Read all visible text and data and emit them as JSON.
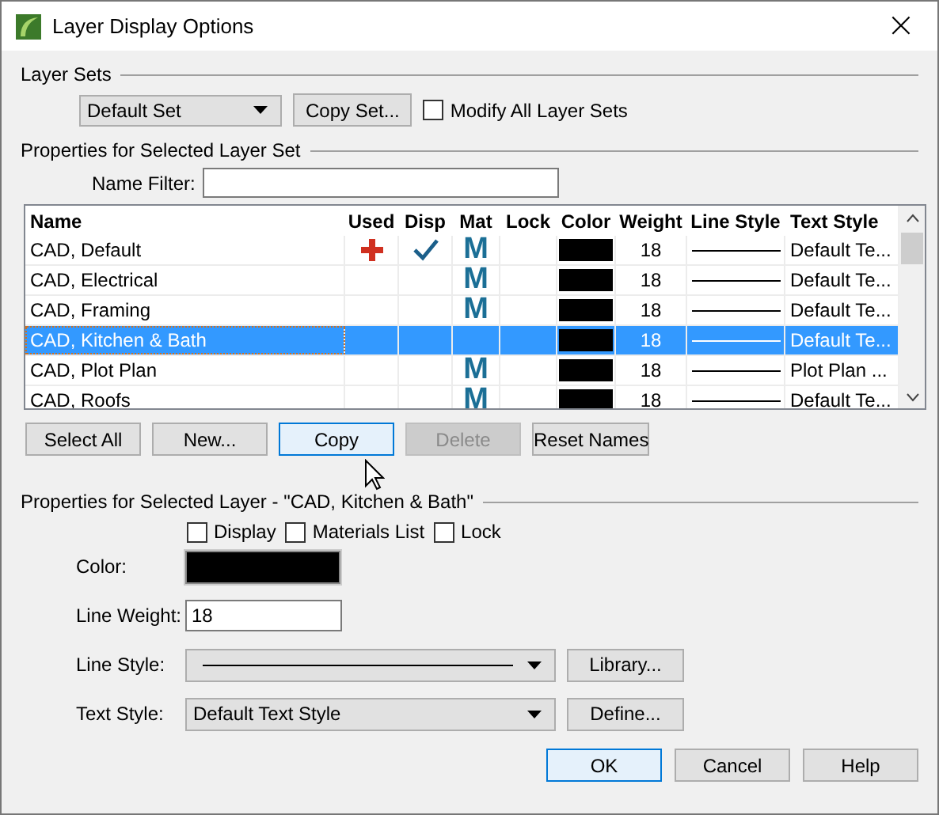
{
  "window": {
    "title": "Layer Display Options",
    "close": "×"
  },
  "layer_sets": {
    "heading": "Layer Sets",
    "set": "Default Set",
    "copy_button": "Copy Set...",
    "modify_all": {
      "label": "Modify All Layer Sets",
      "checked": false
    }
  },
  "layer_set_properties": {
    "heading": "Properties for Selected Layer Set",
    "name_filter_label": "Name Filter:"
  },
  "table": {
    "columns": [
      "Name",
      "Used",
      "Disp",
      "Mat",
      "Lock",
      "Color",
      "Weight",
      "Line Style",
      "Text Style"
    ],
    "rows": [
      {
        "name": "CAD,  Default",
        "used": true,
        "displayed": true,
        "mat": "M",
        "locked": false,
        "color": "#000000",
        "weight": "18",
        "text_style": "Default Te...",
        "selected": false
      },
      {
        "name": "CAD, Electrical",
        "used": false,
        "displayed": false,
        "mat": "M",
        "locked": false,
        "color": "#000000",
        "weight": "18",
        "text_style": "Default Te...",
        "selected": false
      },
      {
        "name": "CAD, Framing",
        "used": false,
        "displayed": false,
        "mat": "M",
        "locked": false,
        "color": "#000000",
        "weight": "18",
        "text_style": "Default Te...",
        "selected": false
      },
      {
        "name": "CAD, Kitchen & Bath",
        "used": false,
        "displayed": false,
        "locked": false,
        "color": "#000000",
        "weight": "18",
        "text_style": "Default Te...",
        "selected": true
      },
      {
        "name": "CAD, Plot Plan",
        "used": false,
        "displayed": false,
        "mat": "M",
        "locked": false,
        "color": "#000000",
        "weight": "18",
        "text_style": "Plot Plan ...",
        "selected": false
      },
      {
        "name": "CAD, Roofs",
        "used": false,
        "displayed": false,
        "mat": "M",
        "locked": false,
        "color": "#000000",
        "weight": "18",
        "text_style": "Default Te...",
        "selected": false
      }
    ]
  },
  "table_buttons": [
    {
      "label": "Select All",
      "disabled": false,
      "focused": false
    },
    {
      "label": "New...",
      "disabled": false,
      "focused": false
    },
    {
      "label": "Copy",
      "disabled": false,
      "focused": true
    },
    {
      "label": "Delete",
      "disabled": true,
      "focused": false
    },
    {
      "label": "Reset Names",
      "disabled": false,
      "focused": false
    }
  ],
  "layer_properties": {
    "heading": "Properties for Selected Layer - \"CAD, Kitchen & Bath\"",
    "checkboxes": [
      {
        "label": "Display",
        "checked": false
      },
      {
        "label": "Materials List",
        "checked": false
      },
      {
        "label": "Lock",
        "checked": false
      }
    ],
    "color_label": "Color:",
    "color": "#000000",
    "line_weight_label": "Line Weight:",
    "line_weight": "18",
    "line_style_label": "Line Style:",
    "library_button": "Library...",
    "text_style_label": "Text Style:",
    "text_style": "Default Text Style",
    "define_button": "Define..."
  },
  "buttons": [
    "OK",
    "Cancel",
    "Help"
  ]
}
